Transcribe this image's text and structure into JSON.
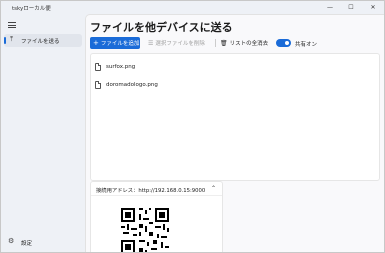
{
  "window": {
    "title": "tskyローカル便"
  },
  "caption_buttons": {
    "minimize": "—",
    "maximize": "☐",
    "close": "✕"
  },
  "sidebar": {
    "items": [
      {
        "label": "ファイルを送る",
        "icon": "upload-icon"
      }
    ],
    "settings_label": "設定",
    "settings_icon": "gear-icon"
  },
  "main": {
    "title": "ファイルを他デバイスに送る",
    "toolbar": {
      "add_label": "ファイルを追加",
      "delete_selected_label": "選択ファイルを削除",
      "clear_all_label": "リストの全消去",
      "share_toggle_label": "共有オン",
      "share_on": true
    },
    "files": [
      {
        "name": "surfox.png",
        "icon": "file-icon"
      },
      {
        "name": "doromadologo.png",
        "icon": "file-icon"
      }
    ],
    "connection": {
      "label": "接続用アドレス：http://192.168.0.15:9000",
      "expanded": true
    }
  },
  "colors": {
    "accent": "#1a6bd8"
  }
}
